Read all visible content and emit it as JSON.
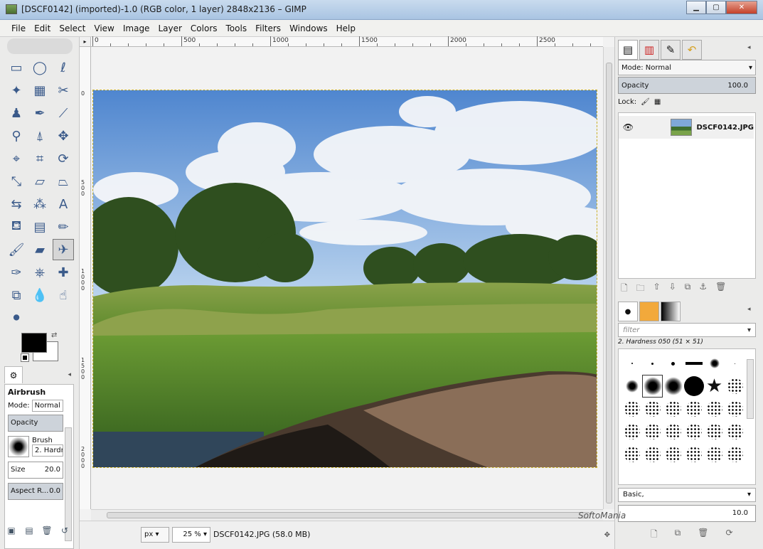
{
  "window": {
    "title": "[DSCF0142] (imported)-1.0 (RGB color, 1 layer) 2848x2136 – GIMP",
    "minimize": "▁",
    "maximize": "▢",
    "close": "✕"
  },
  "menu": [
    "File",
    "Edit",
    "Select",
    "View",
    "Image",
    "Layer",
    "Colors",
    "Tools",
    "Filters",
    "Windows",
    "Help"
  ],
  "toolbox": {
    "tools": [
      {
        "name": "rect-select-icon",
        "glyph": "▭"
      },
      {
        "name": "ellipse-select-icon",
        "glyph": "◯"
      },
      {
        "name": "free-select-icon",
        "glyph": "ℓ"
      },
      {
        "name": "fuzzy-select-icon",
        "glyph": "✦"
      },
      {
        "name": "select-by-color-icon",
        "glyph": "▦"
      },
      {
        "name": "scissors-icon",
        "glyph": "✂"
      },
      {
        "name": "foreground-select-icon",
        "glyph": "♟"
      },
      {
        "name": "paths-icon",
        "glyph": "✒"
      },
      {
        "name": "color-picker-icon",
        "glyph": "⟋"
      },
      {
        "name": "zoom-icon",
        "glyph": "⚲"
      },
      {
        "name": "measure-icon",
        "glyph": "⍋"
      },
      {
        "name": "move-icon",
        "glyph": "✥"
      },
      {
        "name": "align-icon",
        "glyph": "⌖"
      },
      {
        "name": "crop-icon",
        "glyph": "⌗"
      },
      {
        "name": "rotate-icon",
        "glyph": "⟳"
      },
      {
        "name": "scale-icon",
        "glyph": "⤡"
      },
      {
        "name": "shear-icon",
        "glyph": "▱"
      },
      {
        "name": "perspective-icon",
        "glyph": "⏢"
      },
      {
        "name": "flip-icon",
        "glyph": "⇆"
      },
      {
        "name": "cage-icon",
        "glyph": "⁂"
      },
      {
        "name": "text-icon",
        "glyph": "A"
      },
      {
        "name": "bucket-fill-icon",
        "glyph": "⛾"
      },
      {
        "name": "blend-icon",
        "glyph": "▤"
      },
      {
        "name": "pencil-icon",
        "glyph": "✏"
      },
      {
        "name": "paintbrush-icon",
        "glyph": "🖌"
      },
      {
        "name": "eraser-icon",
        "glyph": "▰"
      },
      {
        "name": "airbrush-icon",
        "glyph": "✈"
      },
      {
        "name": "ink-icon",
        "glyph": "✑"
      },
      {
        "name": "clone-icon",
        "glyph": "⎈"
      },
      {
        "name": "heal-icon",
        "glyph": "✚"
      },
      {
        "name": "perspective-clone-icon",
        "glyph": "⧉"
      },
      {
        "name": "blur-icon",
        "glyph": "💧"
      },
      {
        "name": "smudge-icon",
        "glyph": "☝"
      },
      {
        "name": "dodge-burn-icon",
        "glyph": "⚫"
      }
    ],
    "active_tool_index": 26,
    "fg_color": "#000000",
    "bg_color": "#ffffff"
  },
  "tool_options": {
    "tab_glyph": "⚙",
    "title": "Airbrush",
    "mode_label": "Mode:",
    "mode_value": "Normal",
    "opacity_label": "Opacity",
    "brush_label": "Brush",
    "brush_value": "2. Hardn",
    "size_label": "Size",
    "size_value": "20.0",
    "aspect_label": "Aspect R...",
    "aspect_value": "0.0"
  },
  "ruler": {
    "labels": [
      "0",
      "500",
      "1000",
      "1500",
      "2000",
      "2500"
    ],
    "vertical_labels": [
      "0",
      "500",
      "1000",
      "1500",
      "2000"
    ]
  },
  "status": {
    "unit": "px",
    "zoom": "25 %",
    "info": "DSCF0142.JPG (58.0 MB)"
  },
  "layers": {
    "mode_label": "Mode: Normal",
    "opacity_label": "Opacity",
    "opacity_value": "100.0",
    "lock_label": "Lock:",
    "layer_name": "DSCF0142.JPG"
  },
  "brushes": {
    "filter_placeholder": "filter",
    "selected_brush": "2. Hardness 050 (51 × 51)",
    "tag_value": "Basic,",
    "spacing_value": "10.0"
  },
  "watermark": "SoftoMania"
}
